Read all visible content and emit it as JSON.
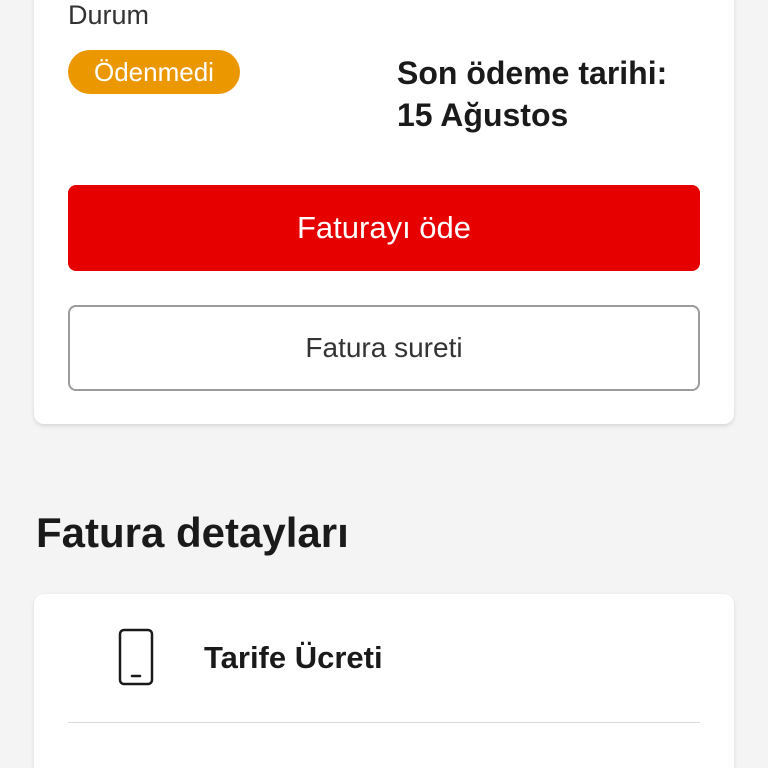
{
  "bill": {
    "status_label": "Durum",
    "status_badge": "Ödenmedi",
    "due_line1": "Son ödeme tarihi:",
    "due_line2": "15 Ağustos",
    "pay_button": "Faturayı öde",
    "copy_button": "Fatura sureti"
  },
  "details": {
    "title": "Fatura detayları",
    "items": [
      {
        "label": "Tarife Ücreti",
        "icon": "phone-icon"
      }
    ]
  },
  "colors": {
    "accent": "#e60000",
    "badge": "#eb9700",
    "background": "#f4f4f4"
  }
}
